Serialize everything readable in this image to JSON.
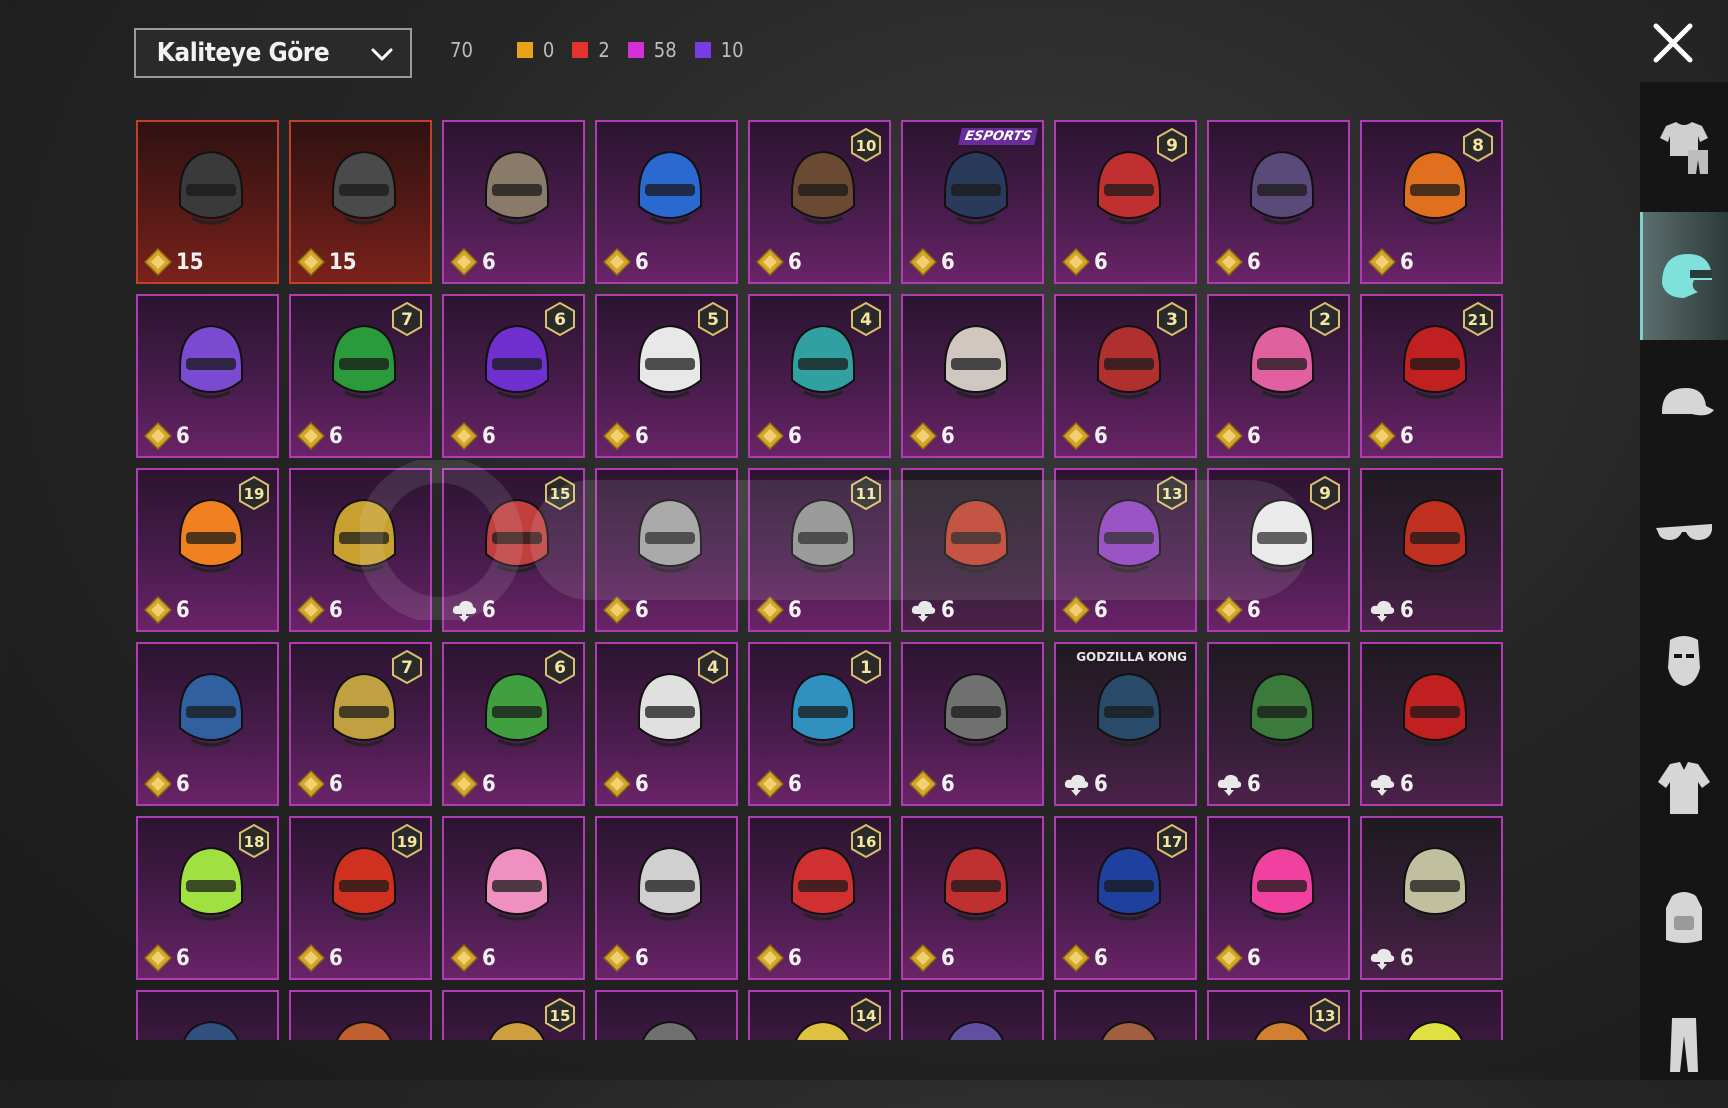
{
  "sort": {
    "label": "Kaliteye Göre"
  },
  "counts": {
    "total": "70",
    "items": [
      {
        "color": "#e8a317",
        "value": "0"
      },
      {
        "color": "#e23333",
        "value": "2"
      },
      {
        "color": "#d52fd6",
        "value": "58"
      },
      {
        "color": "#7a3ce0",
        "value": "10"
      }
    ]
  },
  "grid": {
    "items": [
      {
        "price": "15",
        "rarity": "red",
        "level": "",
        "badge": ""
      },
      {
        "price": "15",
        "rarity": "red",
        "level": "",
        "badge": ""
      },
      {
        "price": "6",
        "rarity": "purple",
        "level": "",
        "badge": ""
      },
      {
        "price": "6",
        "rarity": "purple",
        "level": "",
        "badge": ""
      },
      {
        "price": "6",
        "rarity": "purple",
        "level": "10",
        "badge": ""
      },
      {
        "price": "6",
        "rarity": "purple",
        "level": "",
        "badge": "ESPORTS"
      },
      {
        "price": "6",
        "rarity": "purple",
        "level": "9",
        "badge": ""
      },
      {
        "price": "6",
        "rarity": "purple",
        "level": "",
        "badge": ""
      },
      {
        "price": "6",
        "rarity": "purple",
        "level": "8",
        "badge": ""
      },
      {
        "price": "6",
        "rarity": "purple",
        "level": "",
        "badge": ""
      },
      {
        "price": "6",
        "rarity": "purple",
        "level": "7",
        "badge": ""
      },
      {
        "price": "6",
        "rarity": "purple",
        "level": "6",
        "badge": ""
      },
      {
        "price": "6",
        "rarity": "purple",
        "level": "5",
        "badge": ""
      },
      {
        "price": "6",
        "rarity": "purple",
        "level": "4",
        "badge": ""
      },
      {
        "price": "6",
        "rarity": "purple",
        "level": "",
        "badge": ""
      },
      {
        "price": "6",
        "rarity": "purple",
        "level": "3",
        "badge": ""
      },
      {
        "price": "6",
        "rarity": "purple",
        "level": "2",
        "badge": ""
      },
      {
        "price": "6",
        "rarity": "purple",
        "level": "21",
        "badge": ""
      },
      {
        "price": "6",
        "rarity": "purple",
        "level": "19",
        "badge": ""
      },
      {
        "price": "6",
        "rarity": "purple",
        "level": "",
        "badge": ""
      },
      {
        "price": "6",
        "rarity": "purple",
        "level": "15",
        "badge": "",
        "cloud": true
      },
      {
        "price": "6",
        "rarity": "purple",
        "level": "",
        "badge": ""
      },
      {
        "price": "6",
        "rarity": "purple",
        "level": "11",
        "badge": ""
      },
      {
        "price": "6",
        "rarity": "dim",
        "level": "",
        "badge": "",
        "cloud": true
      },
      {
        "price": "6",
        "rarity": "purple",
        "level": "13",
        "badge": ""
      },
      {
        "price": "6",
        "rarity": "purple",
        "level": "9",
        "badge": ""
      },
      {
        "price": "6",
        "rarity": "dim",
        "level": "",
        "badge": "",
        "cloud": true
      },
      {
        "price": "6",
        "rarity": "purple",
        "level": "",
        "badge": ""
      },
      {
        "price": "6",
        "rarity": "purple",
        "level": "7",
        "badge": ""
      },
      {
        "price": "6",
        "rarity": "purple",
        "level": "6",
        "badge": ""
      },
      {
        "price": "6",
        "rarity": "purple",
        "level": "4",
        "badge": ""
      },
      {
        "price": "6",
        "rarity": "purple",
        "level": "1",
        "badge": ""
      },
      {
        "price": "6",
        "rarity": "purple",
        "level": "",
        "badge": ""
      },
      {
        "price": "6",
        "rarity": "dim",
        "level": "",
        "badge": "GODZILLA KONG",
        "cloud": true
      },
      {
        "price": "6",
        "rarity": "dim",
        "level": "",
        "badge": "",
        "cloud": true
      },
      {
        "price": "6",
        "rarity": "dim",
        "level": "",
        "badge": "",
        "cloud": true
      },
      {
        "price": "6",
        "rarity": "purple",
        "level": "18",
        "badge": ""
      },
      {
        "price": "6",
        "rarity": "purple",
        "level": "19",
        "badge": ""
      },
      {
        "price": "6",
        "rarity": "purple",
        "level": "",
        "badge": ""
      },
      {
        "price": "6",
        "rarity": "purple",
        "level": "",
        "badge": ""
      },
      {
        "price": "6",
        "rarity": "purple",
        "level": "16",
        "badge": ""
      },
      {
        "price": "6",
        "rarity": "purple",
        "level": "",
        "badge": ""
      },
      {
        "price": "6",
        "rarity": "purple",
        "level": "17",
        "badge": ""
      },
      {
        "price": "6",
        "rarity": "purple",
        "level": "",
        "badge": ""
      },
      {
        "price": "6",
        "rarity": "dim",
        "level": "",
        "badge": "",
        "cloud": true
      },
      {
        "price": "",
        "rarity": "purple",
        "level": "",
        "badge": ""
      },
      {
        "price": "",
        "rarity": "purple",
        "level": "",
        "badge": ""
      },
      {
        "price": "",
        "rarity": "purple",
        "level": "15",
        "badge": ""
      },
      {
        "price": "",
        "rarity": "purple",
        "level": "",
        "badge": ""
      },
      {
        "price": "",
        "rarity": "purple",
        "level": "14",
        "badge": ""
      },
      {
        "price": "",
        "rarity": "purple",
        "level": "",
        "badge": ""
      },
      {
        "price": "",
        "rarity": "purple",
        "level": "",
        "badge": ""
      },
      {
        "price": "",
        "rarity": "purple",
        "level": "13",
        "badge": ""
      },
      {
        "price": "",
        "rarity": "purple",
        "level": "",
        "badge": ""
      }
    ],
    "helmet_colors": [
      "#3a3a3a",
      "#4a4a4a",
      "#8a7a6a",
      "#2a6ad0",
      "#6b4a33",
      "#2a3a5a",
      "#c03030",
      "#5a4a7a",
      "#e07020",
      "#7a4ad0",
      "#2a9a3a",
      "#7030d0",
      "#e8e8e8",
      "#30a0a0",
      "#d0c8c0",
      "#b03030",
      "#e060a0",
      "#c02020",
      "#f08020",
      "#c8a030",
      "#c04040",
      "#a0a0a0",
      "#909090",
      "#c04030",
      "#9040c0",
      "#e8e8e8",
      "#c03020",
      "#3060a0",
      "#c0a040",
      "#40a040",
      "#e0e0e0",
      "#3090c0",
      "#707070",
      "#2a4a6a",
      "#3a7a3a",
      "#c02020",
      "#a0e040",
      "#d03020",
      "#f090c0",
      "#d0d0d0",
      "#d03030",
      "#c03030",
      "#2040a0",
      "#f040a0",
      "#c0c0a0",
      "#305080",
      "#c06030",
      "#d0a040",
      "#707070",
      "#e0c040",
      "#6050a0",
      "#a06040",
      "#d08030",
      "#e0e040"
    ]
  },
  "sidebar": {
    "tabs": [
      {
        "icon": "outfit-icon"
      },
      {
        "icon": "helmet-icon"
      },
      {
        "icon": "cap-icon"
      },
      {
        "icon": "glasses-icon"
      },
      {
        "icon": "mask-icon"
      },
      {
        "icon": "jacket-icon"
      },
      {
        "icon": "backpack-icon"
      },
      {
        "icon": "pants-icon"
      }
    ],
    "active_index": 1
  }
}
